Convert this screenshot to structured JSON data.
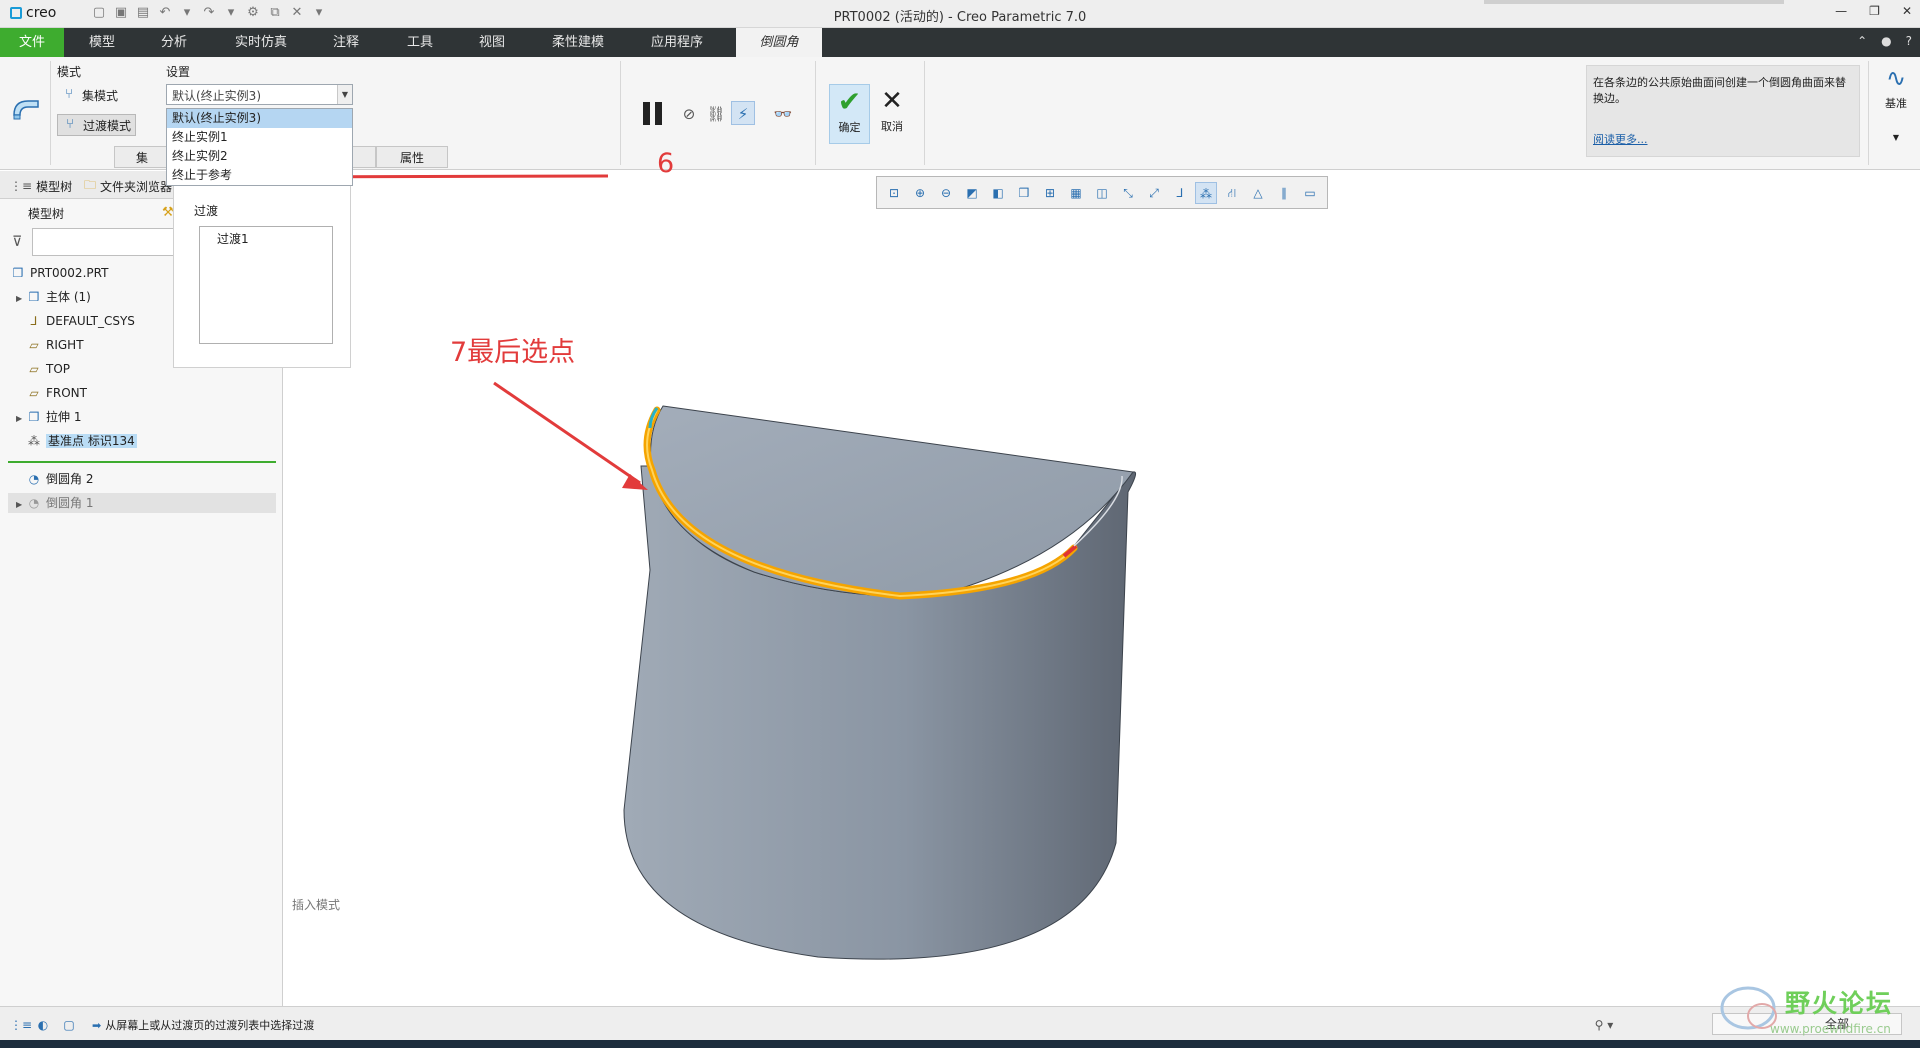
{
  "title_bar": {
    "app_logo": "creo",
    "window_title": "PRT0002 (活动的) - Creo Parametric 7.0",
    "controls": [
      "—",
      "❐",
      "✕"
    ]
  },
  "ribbon_tabs": {
    "file": "文件",
    "model": "模型",
    "analysis": "分析",
    "simulation": "实时仿真",
    "annotate": "注释",
    "tools": "工具",
    "view": "视图",
    "flexible": "柔性建模",
    "applications": "应用程序",
    "round": "倒圆角"
  },
  "ribbon": {
    "mode_label": "模式",
    "set_mode": "集模式",
    "transition_mode": "过渡模式",
    "settings_label": "设置",
    "combo_value": "默认(终止实例3)",
    "dropdown_options": [
      "默认(终止实例3)",
      "终止实例1",
      "终止实例2",
      "终止于参考"
    ],
    "subtab_sets": "集",
    "subtab_properties": "属性",
    "ok_label": "确定",
    "cancel_label": "取消",
    "help_text": "在各条边的公共原始曲面间创建一个倒圆角曲面来替换边。",
    "help_link": "阅读更多...",
    "datum_label": "基准"
  },
  "left_panel": {
    "tab_model_tree": "模型树",
    "tab_folder_browser": "文件夹浏览器",
    "tree_header": "模型树",
    "items": {
      "part": "PRT0002.PRT",
      "body": "主体 (1)",
      "csys": "DEFAULT_CSYS",
      "right": "RIGHT",
      "top": "TOP",
      "front": "FRONT",
      "extrude": "拉伸 1",
      "datum_point": "基准点 标识134",
      "round2": "倒圆角 2",
      "round1": "倒圆角 1"
    }
  },
  "transitions_panel": {
    "label": "过渡",
    "items": [
      "过渡1"
    ]
  },
  "graphics": {
    "insert_mode": "插入模式"
  },
  "annotations": {
    "step6": "6",
    "step7": "7最后选点"
  },
  "status_bar": {
    "message": "从屏幕上或从过渡页的过渡列表中选择过渡",
    "filter_value": "全部"
  },
  "watermark": {
    "text": "野火论坛",
    "url": "www.proewildfire.cn"
  },
  "colors": {
    "file_tab": "#3eac2f",
    "tab_bar": "#2f3436",
    "annotation": "#e23b3b",
    "edge_highlight": "#f5a400",
    "solid_body": "#8e98a4"
  }
}
